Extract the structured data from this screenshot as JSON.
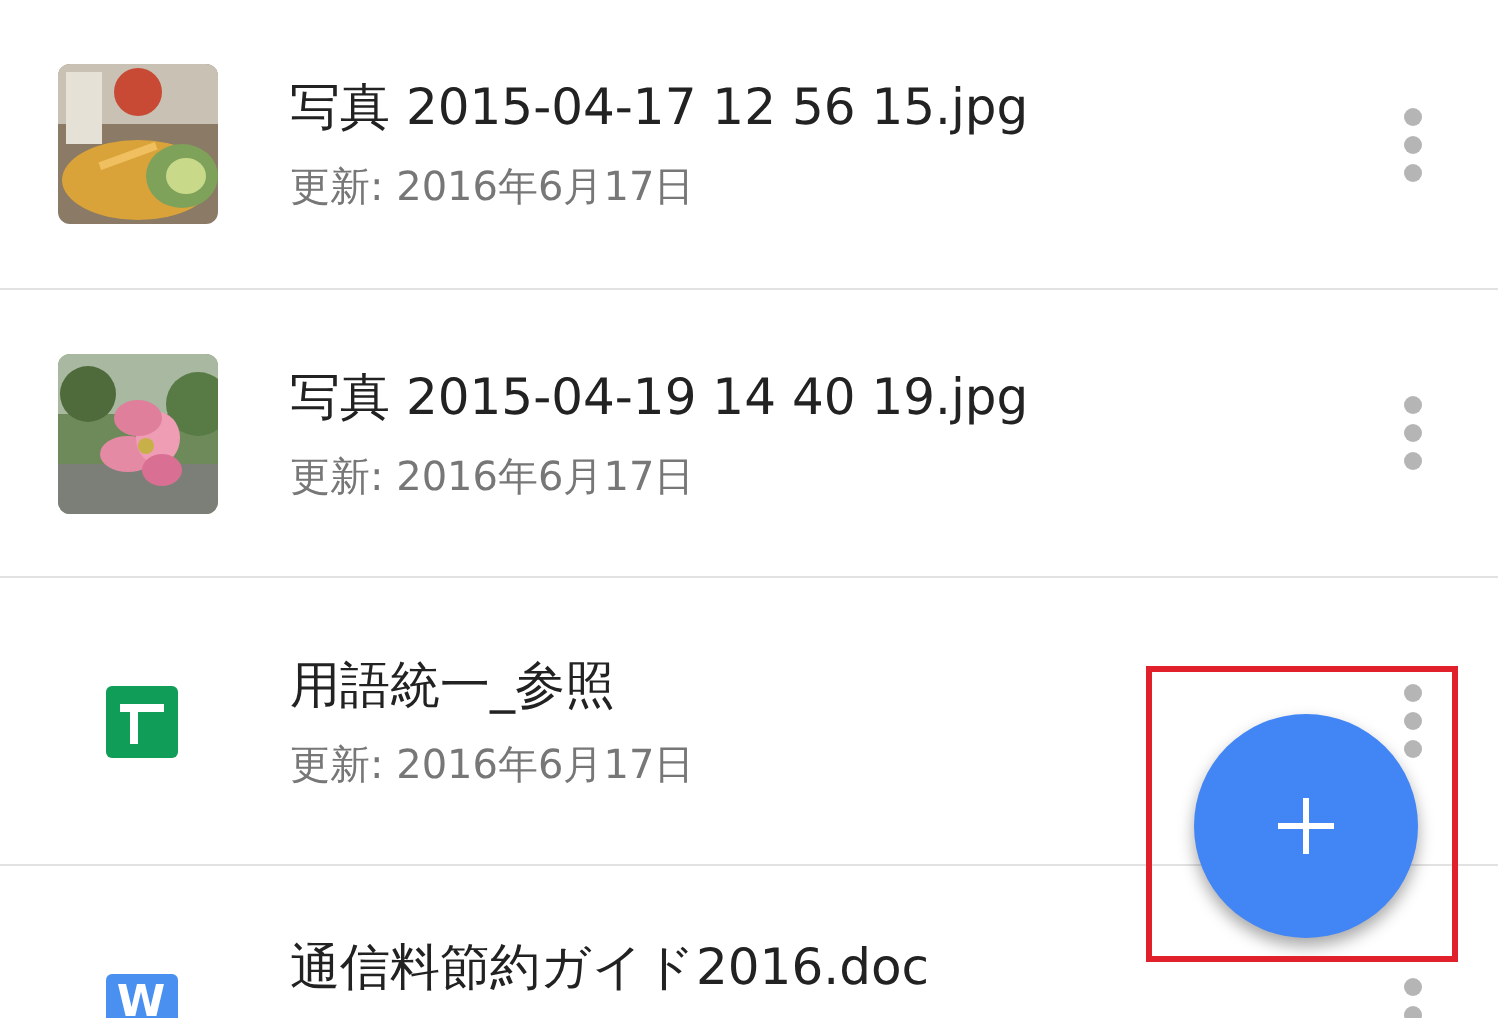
{
  "files": [
    {
      "title": "写真 2015-04-17 12 56 15.jpg",
      "subtitle": "更新: 2016年6月17日"
    },
    {
      "title": "写真 2015-04-19 14 40 19.jpg",
      "subtitle": "更新: 2016年6月17日"
    },
    {
      "kind": "sheet",
      "title": "用語統一_参照",
      "subtitle": "更新: 2016年6月17日"
    },
    {
      "kind": "doc",
      "title": "通信料節約ガイド2016.doc",
      "icon_letter": "W"
    }
  ],
  "fab": {
    "highlighted": true
  }
}
